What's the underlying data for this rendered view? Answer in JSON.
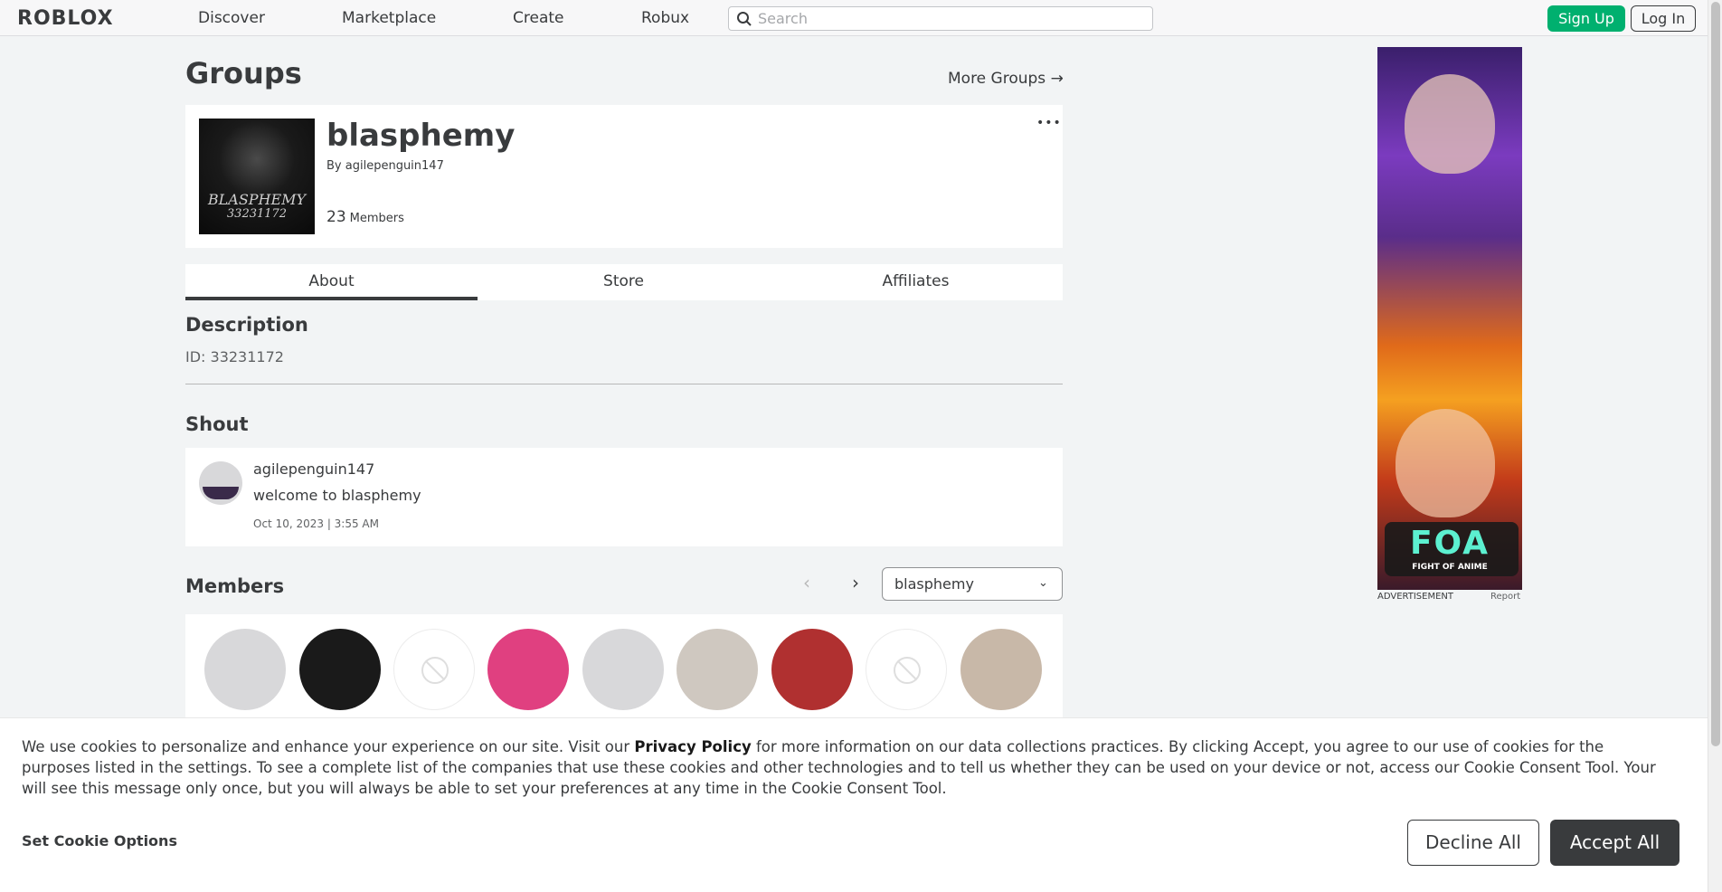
{
  "nav": {
    "logo": "ROBLOX",
    "links": [
      "Discover",
      "Marketplace",
      "Create",
      "Robux"
    ],
    "search_placeholder": "Search",
    "signup_label": "Sign Up",
    "login_label": "Log In"
  },
  "page": {
    "title": "Groups",
    "more_groups": "More Groups →"
  },
  "group": {
    "name": "blasphemy",
    "owner_prefix": "By",
    "owner": "agilepenguin147",
    "member_count": "23",
    "member_label": "Members",
    "emblem_text_1": "BLASPHEMY",
    "emblem_text_2": "33231172",
    "more_menu": "•••"
  },
  "tabs": [
    "About",
    "Store",
    "Affiliates"
  ],
  "description": {
    "title": "Description",
    "text": "ID: 33231172"
  },
  "shout": {
    "title": "Shout",
    "user": "agilepenguin147",
    "message": "welcome to blasphemy",
    "date": "Oct 10, 2023 | 3:55 AM"
  },
  "members": {
    "title": "Members",
    "role_selected": "blasphemy",
    "avatars": [
      "avatar",
      "avatar",
      "empty",
      "avatar",
      "avatar",
      "avatar",
      "avatar",
      "empty",
      "avatar"
    ]
  },
  "ad": {
    "logo": "FOA",
    "logo_sub": "FIGHT OF ANIME",
    "label": "ADVERTISEMENT",
    "report": "Report"
  },
  "cookie": {
    "text_before": "We use cookies to personalize and enhance your experience on our site. Visit our ",
    "privacy_link": "Privacy Policy",
    "text_after": " for more information on our data collections practices. By clicking Accept, you agree to our use of cookies for the purposes listed in the settings. To see a complete list of the companies that use these cookies and other technologies and to tell us whether they can be used on your device or not, access our Cookie Consent Tool. Your will see this message only once, but you will always be able to set your preferences at any time in the Cookie Consent Tool.",
    "settings_label": "Set Cookie Options",
    "decline_label": "Decline All",
    "accept_label": "Accept All"
  },
  "colors": {
    "signup": "#00b06f",
    "accept": "#393b3d",
    "background": "#f2f4f5"
  }
}
